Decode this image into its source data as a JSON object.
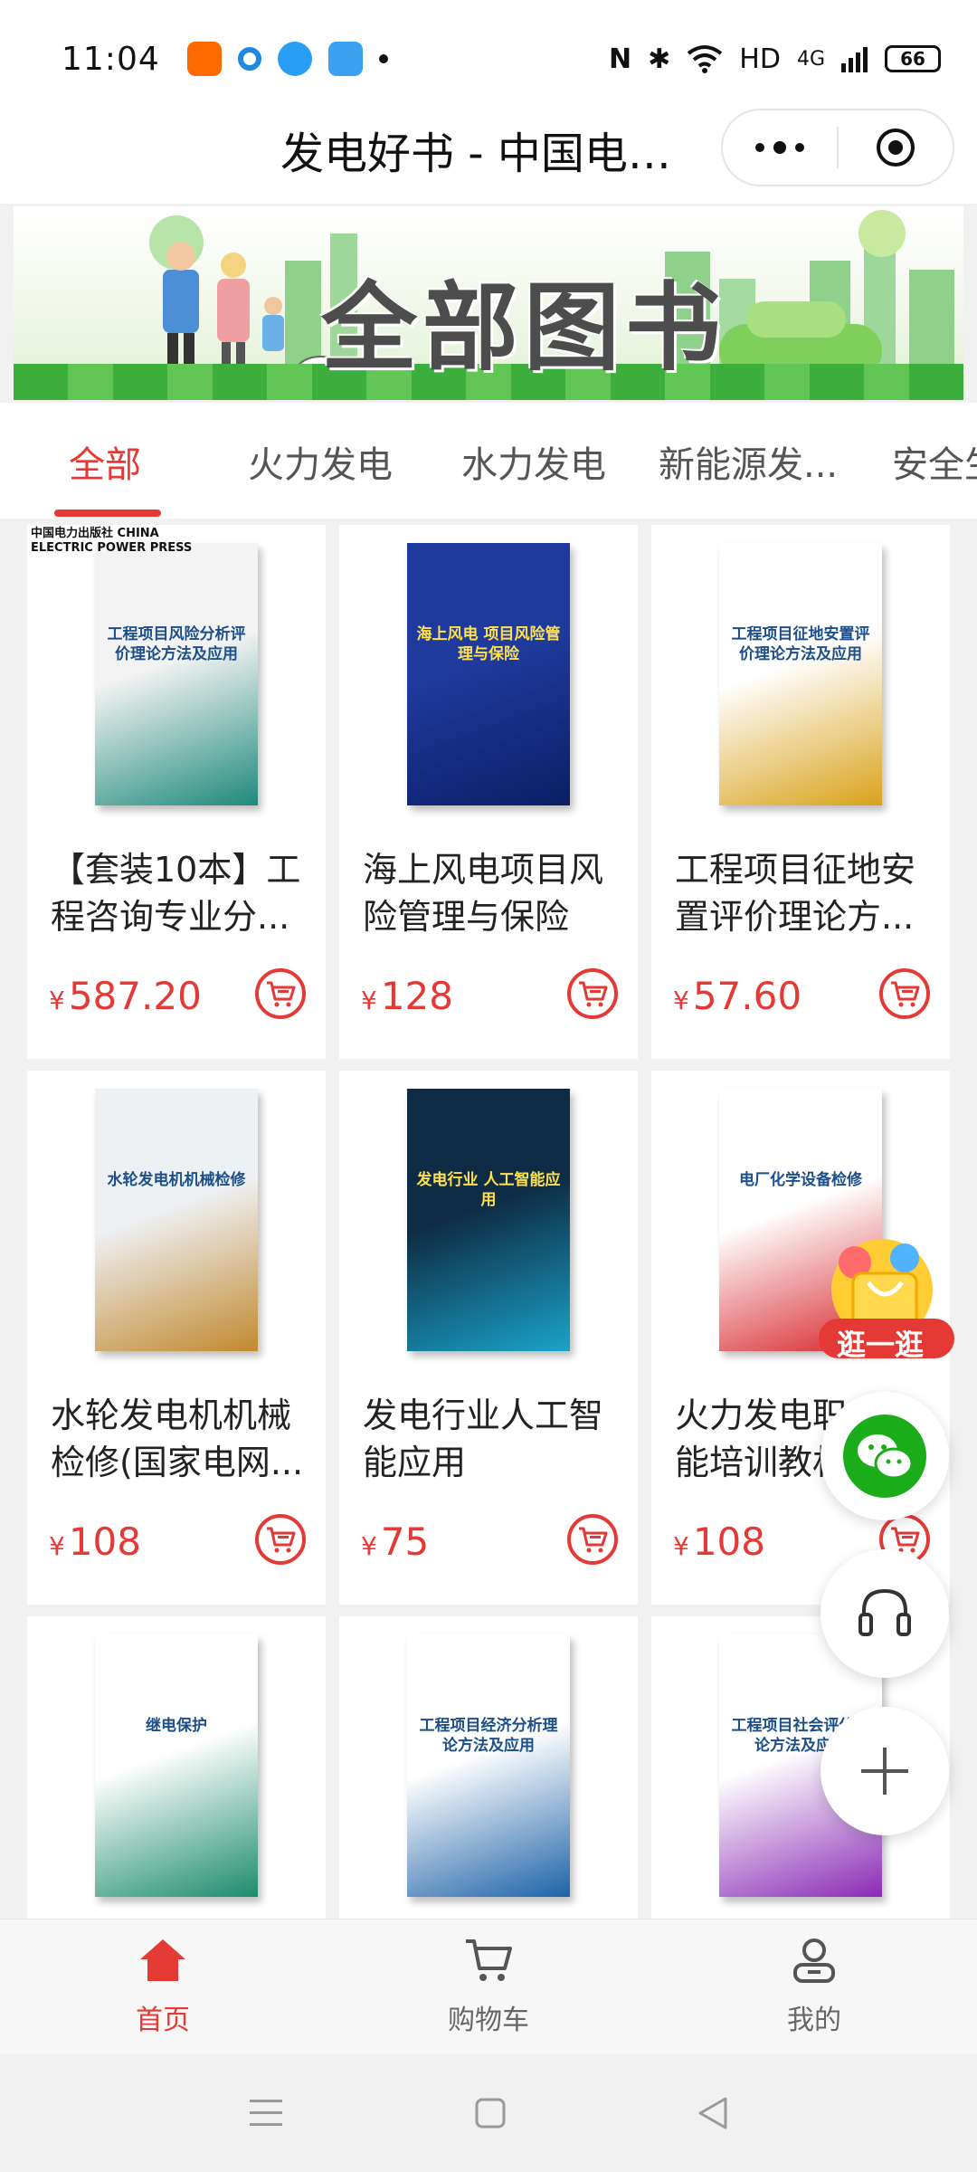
{
  "status_bar": {
    "time": "11:04",
    "network": "HD",
    "signal": "4G",
    "battery": "66"
  },
  "header": {
    "title": "发电好书 - 中国电力出版社"
  },
  "banner": {
    "title": "全部图书"
  },
  "tabs": [
    {
      "label": "全部",
      "active": true
    },
    {
      "label": "火力发电",
      "active": false
    },
    {
      "label": "水力发电",
      "active": false
    },
    {
      "label": "新能源发...",
      "active": false
    },
    {
      "label": "安全生",
      "active": false
    }
  ],
  "currency": "¥",
  "products": [
    {
      "title": "【套装10本】工程咨询专业分...",
      "price": "587.20",
      "cover_text": "工程项目风险分析评价理论方法及应用",
      "cover_colors": [
        "#f3f3f3",
        "#1f8a7a"
      ],
      "publisher_logo": "中国电力出版社 CHINA ELECTRIC POWER PRESS"
    },
    {
      "title": "海上风电项目风险管理与保险",
      "price": "128",
      "cover_text": "海上风电 项目风险管理与保险",
      "cover_colors": [
        "#1e3a9c",
        "#0b1f66"
      ]
    },
    {
      "title": "工程项目征地安置评价理论方...",
      "price": "57.60",
      "cover_text": "工程项目征地安置评价理论方法及应用",
      "cover_colors": [
        "#ffffff",
        "#d9a21b"
      ]
    },
    {
      "title": "水轮发电机机械检修(国家电网...",
      "price": "108",
      "cover_text": "水轮发电机机械检修",
      "cover_colors": [
        "#eef1f4",
        "#c2892f"
      ]
    },
    {
      "title": "发电行业人工智能应用",
      "price": "75",
      "cover_text": "发电行业 人工智能应用",
      "cover_colors": [
        "#0e2c45",
        "#1aa3c8"
      ]
    },
    {
      "title": "火力发电职业技能培训教材",
      "price": "108",
      "cover_text": "电厂化学设备检修",
      "cover_colors": [
        "#ffffff",
        "#d8262b"
      ]
    },
    {
      "title": "",
      "price": "",
      "cover_text": "继电保护",
      "cover_colors": [
        "#ffffff",
        "#1c8c6c"
      ]
    },
    {
      "title": "",
      "price": "",
      "cover_text": "工程项目经济分析理论方法及应用",
      "cover_colors": [
        "#ffffff",
        "#1e63a8"
      ]
    },
    {
      "title": "",
      "price": "",
      "cover_text": "工程项目社会评价理论方法及应用",
      "cover_colors": [
        "#ffffff",
        "#8a2bb5"
      ]
    }
  ],
  "floating": {
    "promo_label": "逛一逛"
  },
  "bottom_nav": [
    {
      "label": "首页",
      "active": true,
      "icon": "home-icon"
    },
    {
      "label": "购物车",
      "active": false,
      "icon": "cart-icon"
    },
    {
      "label": "我的",
      "active": false,
      "icon": "user-icon"
    }
  ],
  "colors": {
    "accent": "#e53935",
    "wechat": "#1aad19"
  }
}
